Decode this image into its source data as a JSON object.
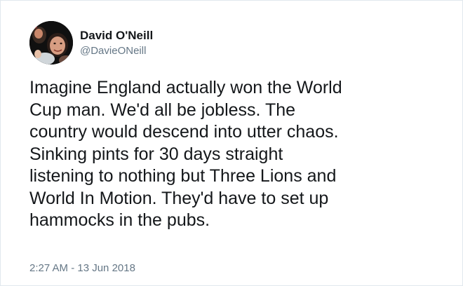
{
  "tweet": {
    "author": {
      "display_name": "David O'Neill",
      "handle": "@DavieONeill"
    },
    "text_lines": [
      "Imagine England actually won the World",
      "Cup man. We'd all be jobless. The",
      "country would descend into utter chaos.",
      "Sinking pints for 30 days straight",
      "listening to nothing but Three Lions and",
      "World In Motion. They'd have to set up",
      "hammocks in the pubs."
    ],
    "timestamp": "2:27 AM - 13 Jun 2018"
  },
  "colors": {
    "text_primary": "#14171a",
    "text_secondary": "#657786",
    "card_background": "#ffffff"
  }
}
